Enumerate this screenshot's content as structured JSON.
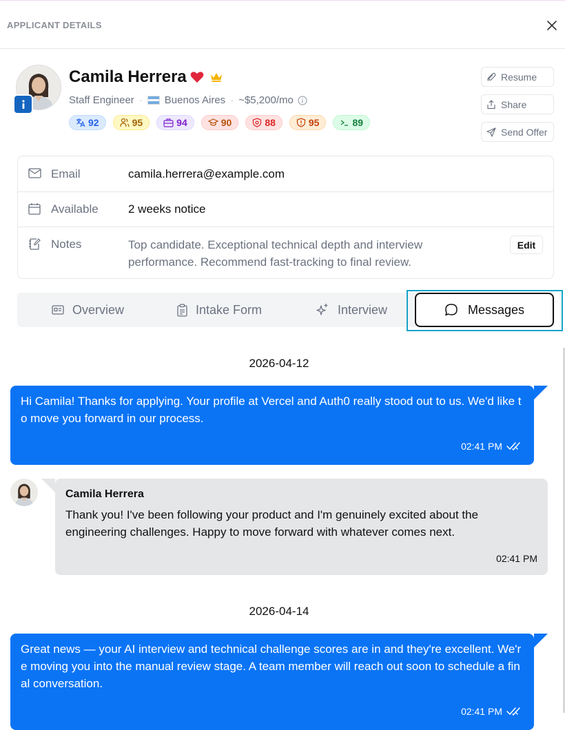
{
  "header": {
    "title": "APPLICANT DETAILS",
    "close_icon": "close-icon"
  },
  "profile": {
    "name": "Camila Herrera",
    "role": "Staff Engineer",
    "location": "Buenos Aires",
    "salary": "~$5,200/mo",
    "scores": [
      {
        "icon": "translate-icon",
        "value": "92",
        "color": "#2563eb",
        "bg": "#dbeafe",
        "border": "#bfdbfe"
      },
      {
        "icon": "users-icon",
        "value": "95",
        "color": "#a16207",
        "bg": "#fef9c3",
        "border": "#fde68a"
      },
      {
        "icon": "briefcase-icon",
        "value": "94",
        "color": "#7e22ce",
        "bg": "#ede9fe",
        "border": "#ddd6fe"
      },
      {
        "icon": "graduation-cap-icon",
        "value": "90",
        "color": "#b45309",
        "bg": "#fee2e2",
        "border": "#fecaca"
      },
      {
        "icon": "shield-alert-icon",
        "value": "88",
        "color": "#dc2626",
        "bg": "#fee2e2",
        "border": "#fecaca"
      },
      {
        "icon": "shield-icon",
        "value": "95",
        "color": "#c2410c",
        "bg": "#ffedd5",
        "border": "#fed7aa"
      },
      {
        "icon": "terminal-icon",
        "value": "89",
        "color": "#15803d",
        "bg": "#dcfce7",
        "border": "#bbf7d0"
      }
    ]
  },
  "actions": {
    "resume": "Resume",
    "share": "Share",
    "send_offer": "Send Offer"
  },
  "details": {
    "email_label": "Email",
    "email_value": "camila.herrera@example.com",
    "available_label": "Available",
    "available_value": "2 weeks notice",
    "notes_label": "Notes",
    "notes_value": "Top candidate. Exceptional technical depth and interview performance. Recommend fast-tracking to final review.",
    "edit_label": "Edit"
  },
  "tabs": {
    "overview": "Overview",
    "intake": "Intake Form",
    "interview": "Interview",
    "messages": "Messages",
    "active": "Messages"
  },
  "messages": {
    "date1": "2026-04-12",
    "msg1": "Hi Camila! Thanks for applying. Your profile at Vercel and Auth0 really stood out to us. We'd like to move you forward in our process.",
    "msg1_time": "02:41 PM",
    "msg2_sender": "Camila Herrera",
    "msg2": "Thank you! I've been following your product and I'm genuinely excited about the engineering challenges. Happy to move forward with whatever comes next.",
    "msg2_time": "02:41 PM",
    "date2": "2026-04-14",
    "msg3": "Great news — your AI interview and technical challenge scores are in and they're excellent. We're moving you into the manual review stage. A team member will reach out soon to schedule a final conversation.",
    "msg3_time": "02:41 PM"
  },
  "colors": {
    "accent": "#0a74f5",
    "focus_ring": "#16a3c7",
    "incoming_bubble": "#e5e6e8"
  }
}
